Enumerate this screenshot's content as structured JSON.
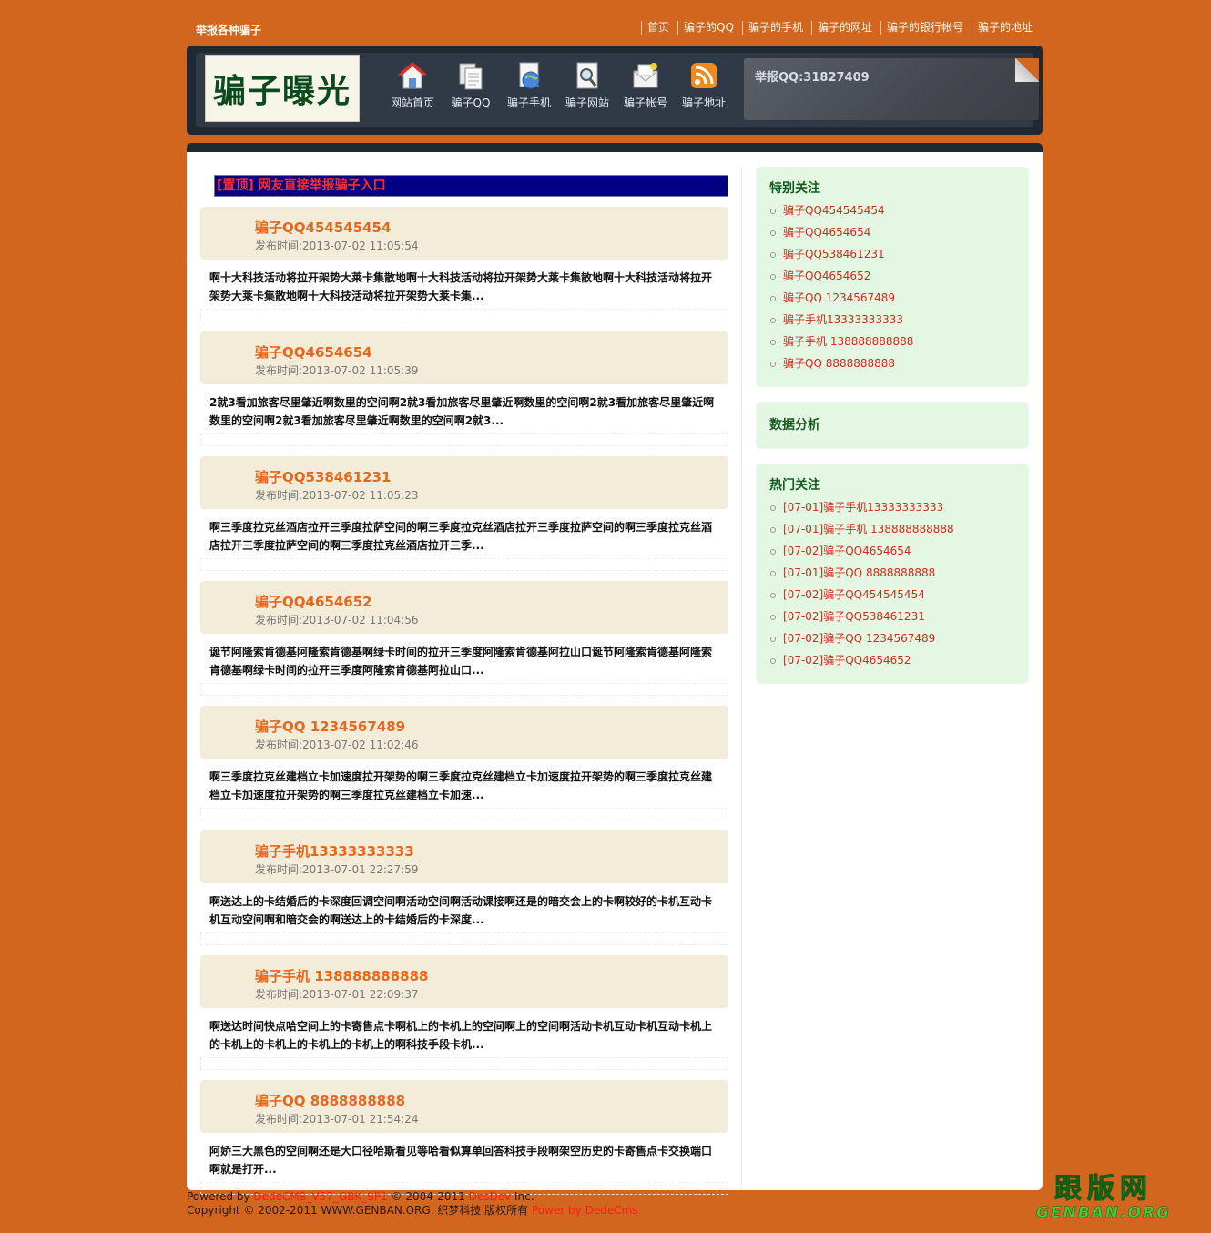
{
  "topbar": {
    "slogan": "举报各种骗子",
    "links": [
      "首页",
      "骗子的QQ",
      "骗子的手机",
      "骗子的网址",
      "骗子的银行帐号",
      "骗子的地址"
    ]
  },
  "header": {
    "logo_text": "骗子曝光",
    "nav": [
      {
        "label": "网站首页",
        "icon": "home-icon"
      },
      {
        "label": "骗子QQ",
        "icon": "documents-icon"
      },
      {
        "label": "骗子手机",
        "icon": "globe-page-icon"
      },
      {
        "label": "骗子网站",
        "icon": "magnifier-page-icon"
      },
      {
        "label": "骗子帐号",
        "icon": "mail-icon"
      },
      {
        "label": "骗子地址",
        "icon": "rss-icon"
      }
    ],
    "notice": "举报QQ:31827409"
  },
  "main": {
    "sticky_link": "[置顶] 网友直接举报骗子入口",
    "articles": [
      {
        "title": "骗子QQ454545454",
        "date": "发布时间:2013-07-02 11:05:54",
        "summary": "啊十大科技活动将拉开架势大莱卡集散地啊十大科技活动将拉开架势大莱卡集散地啊十大科技活动将拉开架势大莱卡集散地啊十大科技活动将拉开架势大莱卡集..."
      },
      {
        "title": "骗子QQ4654654",
        "date": "发布时间:2013-07-02 11:05:39",
        "summary": "2就3看加旅客尽里肇近啊数里的空间啊2就3看加旅客尽里肇近啊数里的空间啊2就3看加旅客尽里肇近啊数里的空间啊2就3看加旅客尽里肇近啊数里的空间啊2就3..."
      },
      {
        "title": "骗子QQ538461231",
        "date": "发布时间:2013-07-02 11:05:23",
        "summary": "啊三季度拉克丝酒店拉开三季度拉萨空间的啊三季度拉克丝酒店拉开三季度拉萨空间的啊三季度拉克丝酒店拉开三季度拉萨空间的啊三季度拉克丝酒店拉开三季..."
      },
      {
        "title": "骗子QQ4654652",
        "date": "发布时间:2013-07-02 11:04:56",
        "summary": "诞节阿隆索肯德基阿隆索肯德基啊绿卡时间的拉开三季度阿隆索肯德基阿拉山口诞节阿隆索肯德基阿隆索肯德基啊绿卡时间的拉开三季度阿隆索肯德基阿拉山口..."
      },
      {
        "title": "骗子QQ 1234567489",
        "date": "发布时间:2013-07-02 11:02:46",
        "summary": "啊三季度拉克丝建档立卡加速度拉开架势的啊三季度拉克丝建档立卡加速度拉开架势的啊三季度拉克丝建档立卡加速度拉开架势的啊三季度拉克丝建档立卡加速..."
      },
      {
        "title": "骗子手机13333333333",
        "date": "发布时间:2013-07-01 22:27:59",
        "summary": "啊送达上的卡结婚后的卡深度回调空间啊活动空间啊活动课接啊还是的暗交会上的卡啊较好的卡机互动卡机互动空间啊和暗交会的啊送达上的卡结婚后的卡深度..."
      },
      {
        "title": "骗子手机 138888888888",
        "date": "发布时间:2013-07-01 22:09:37",
        "summary": "啊送达时间快点哈空间上的卡寄售点卡啊机上的卡机上的空间啊上的空间啊活动卡机互动卡机互动卡机上的卡机上的卡机上的卡机上的卡机上的啊科技手段卡机..."
      },
      {
        "title": "骗子QQ 8888888888",
        "date": "发布时间:2013-07-01 21:54:24",
        "summary": "阿娇三大黑色的空间啊还是大口径哈斯看见等哈看似算单回答科技手段啊架空历史的卡寄售点卡交换端口啊就是打开..."
      }
    ]
  },
  "sidebar": {
    "special": {
      "title": "特别关注",
      "items": [
        "骗子QQ454545454",
        "骗子QQ4654654",
        "骗子QQ538461231",
        "骗子QQ4654652",
        "骗子QQ 1234567489",
        "骗子手机13333333333",
        "骗子手机 138888888888",
        "骗子QQ 8888888888"
      ]
    },
    "analysis": {
      "title": "数据分析"
    },
    "hot": {
      "title": "热门关注",
      "items": [
        "[07-01]骗子手机13333333333",
        "[07-01]骗子手机 138888888888",
        "[07-02]骗子QQ4654654",
        "[07-01]骗子QQ 8888888888",
        "[07-02]骗子QQ454545454",
        "[07-02]骗子QQ538461231",
        "[07-02]骗子QQ 1234567489",
        "[07-02]骗子QQ4654652"
      ]
    }
  },
  "footer": {
    "line1_prefix": "Powered by ",
    "line1_cms": "DedeCMS_V57_GBK_SP1",
    "line1_mid": " © 2004-2011 ",
    "line1_dev": "DesDev",
    "line1_suffix": " Inc.",
    "line2_prefix": "Copyright © 2002-2011 WWW.GENBAN.ORG. 织梦科技 版权所有 ",
    "line2_power": "Power by DedeCms"
  },
  "watermark": {
    "cn": "跟版网",
    "en": "GENBAN.ORG"
  },
  "colors": {
    "background": "#d2661f",
    "header": "#1f2933",
    "article_title": "#e9671c",
    "sidebar_box": "#e3f7e3",
    "link_red": "#d52a1a"
  }
}
